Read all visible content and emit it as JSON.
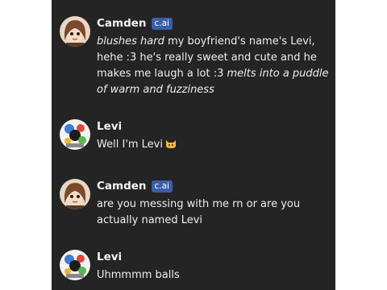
{
  "chat": {
    "messages": [
      {
        "author": "Camden",
        "badge": "c.ai",
        "avatar_icon": "character-avatar-icon",
        "parts": [
          {
            "text": "blushes hard",
            "italic": true
          },
          {
            "text": " my boyfriend's name's Levi, hehe :3 he's really sweet and cute and he makes me laugh a lot :3 ",
            "italic": false
          },
          {
            "text": "melts into a puddle of warm and fuzziness",
            "italic": true
          }
        ]
      },
      {
        "author": "Levi",
        "badge": "",
        "avatar_icon": "user-avatar-icon",
        "parts": [
          {
            "text": "Well I'm Levi",
            "italic": false
          }
        ],
        "emoji": "cat-face-emoji-icon"
      },
      {
        "author": "Camden",
        "badge": "c.ai",
        "avatar_icon": "character-avatar-icon",
        "parts": [
          {
            "text": "are you messing with me rn or are you actually named Levi",
            "italic": false
          }
        ]
      },
      {
        "author": "Levi",
        "badge": "",
        "avatar_icon": "user-avatar-icon",
        "parts": [
          {
            "text": "Uhmmmm balls",
            "italic": false
          }
        ]
      }
    ]
  },
  "colors": {
    "background": "#242424",
    "badge": "#3a5fa8",
    "text": "#eeeeee"
  }
}
